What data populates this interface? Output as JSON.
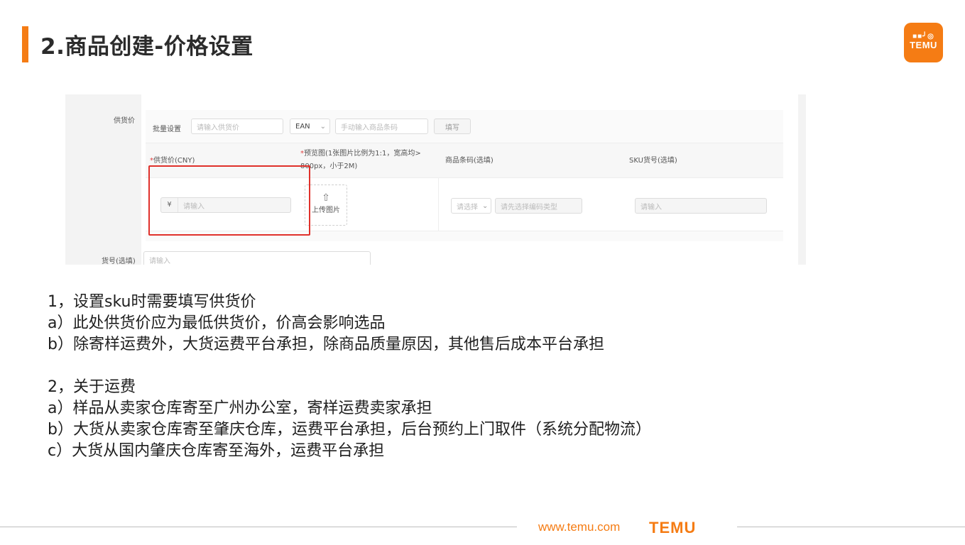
{
  "header": {
    "title": "2.商品创建-价格设置",
    "logo_line1": "■■╯◎",
    "logo_line2": "TEMU"
  },
  "screenshot": {
    "supply_price_label": "供货价",
    "batch_label": "批量设置",
    "batch_input_placeholder": "请输入供货价",
    "code_type_value": "EAN",
    "code_input_placeholder": "手动输入商品条码",
    "fill_button": "填写",
    "columns": [
      {
        "required": "*",
        "label": "供货价(CNY)"
      },
      {
        "required": "*",
        "label": "预览图(1张图片比例为1:1，宽高均>",
        "label2": "800px，小于2M)"
      },
      {
        "required": "",
        "label": "商品条码(选填)"
      },
      {
        "required": "",
        "label": "SKU货号(选填)"
      }
    ],
    "currency_symbol": "¥",
    "price_input_placeholder": "请输入",
    "upload_icon": "upload-icon",
    "upload_label": "上传图片",
    "select_placeholder": "请选择",
    "code_type_placeholder": "请先选择编码类型",
    "sku_input_placeholder": "请输入",
    "item_no_label": "货号(选填)",
    "item_no_placeholder": "请输入"
  },
  "notes": [
    "1，设置sku时需要填写供货价",
    "a）此处供货价应为最低供货价，价高会影响选品",
    "b）除寄样运费外，大货运费平台承担，除商品质量原因，其他售后成本平台承担",
    "2，关于运费",
    "a）样品从卖家仓库寄至广州办公室，寄样运费卖家承担",
    "b）大货从卖家仓库寄至肇庆仓库，运费平台承担，后台预约上门取件（系统分配物流）",
    "c）大货从国内肇庆仓库寄至海外，运费平台承担"
  ],
  "footer": {
    "url": "www.temu.com",
    "logo": "TEMU"
  },
  "colors": {
    "accent": "#f57c14",
    "highlight": "#e0312b"
  }
}
